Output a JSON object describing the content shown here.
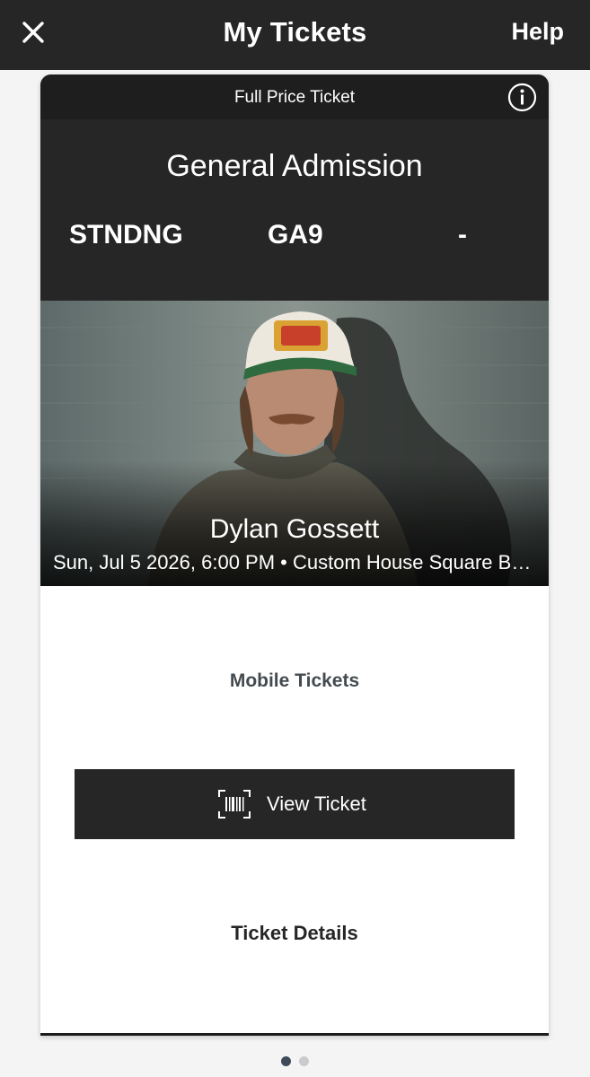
{
  "header": {
    "title": "My Tickets",
    "help_label": "Help",
    "close_icon": "close-icon"
  },
  "ticket": {
    "price_type": "Full Price Ticket",
    "info_icon": "info-icon",
    "admission": "General Admission",
    "section": "STNDNG",
    "row": "GA9",
    "seat": "-",
    "artist": "Dylan Gossett",
    "event_info": "Sun, Jul 5 2026, 6:00 PM • Custom House Square Bel...",
    "mobile_tickets_label": "Mobile Tickets",
    "view_ticket_label": "View Ticket",
    "barcode_icon": "barcode-icon",
    "ticket_details_label": "Ticket Details"
  },
  "pager": {
    "total": 2,
    "active": 1
  },
  "colors": {
    "header_bg": "#262626",
    "page_bg": "#f4f4f4",
    "button_bg": "#262626",
    "dot_active": "#3e4a59",
    "dot_inactive": "#c9cbcd"
  }
}
